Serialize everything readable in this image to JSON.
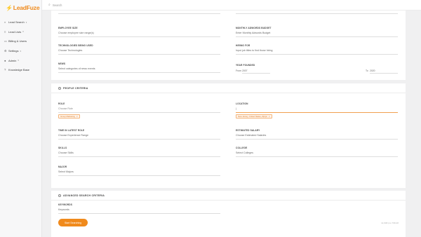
{
  "app": {
    "logo_text": "LeadFuze",
    "brand_color": "#f08a1c"
  },
  "search": {
    "placeholder": "Search",
    "icon": "search-icon"
  },
  "sidebar": {
    "items": [
      {
        "icon": "search-icon",
        "label": "Lead Search",
        "has_chevron": true
      },
      {
        "icon": "list-icon",
        "label": "Lead Lists",
        "has_chevron": true
      },
      {
        "icon": "card-icon",
        "label": "Billing & Users",
        "has_chevron": false
      },
      {
        "icon": "gear-icon",
        "label": "Settings",
        "has_chevron": true
      },
      {
        "icon": "user-icon",
        "label": "Admin",
        "has_chevron": true
      },
      {
        "icon": "help-icon",
        "label": "Knowledge Base",
        "has_chevron": false
      }
    ]
  },
  "company": {
    "employee_size": {
      "label": "EMPLOYEE SIZE",
      "value": "Choose employee size range(s)"
    },
    "adwords": {
      "label": "MONTHLY ADWORDS BUDGET",
      "value": "Enter Monthly Adwords Budget"
    },
    "tech": {
      "label": "TECHNOLOGIES BEING USED",
      "value": "Choose Technologies"
    },
    "hiring": {
      "label": "HIRING FOR",
      "value": "Input job titles to find those hiring"
    },
    "news": {
      "label": "NEWS",
      "value": "Select categories of news events"
    },
    "year_founded": {
      "label": "YEAR FOUNDED",
      "from_label": "From",
      "from_value": "2007",
      "to_label": "To",
      "to_value": "2020"
    }
  },
  "people": {
    "title": "PEOPLE CRITERIA",
    "role": {
      "label": "ROLE",
      "value": "Choose Role",
      "tag": "Group Marketing"
    },
    "location": {
      "label": "LOCATION",
      "value": "|",
      "tag": "New Jersey, United States, Zip/pc"
    },
    "time_in_role": {
      "label": "TIME IN LATEST ROLE",
      "value": "Choose Experience Range"
    },
    "salary": {
      "label": "ESTIMATED SALARY",
      "value": "Choose Estimated Salaries"
    },
    "skills": {
      "label": "SKILLS",
      "value": "Choose Skills"
    },
    "college": {
      "label": "COLLEGE",
      "value": "Select Colleges"
    },
    "major": {
      "label": "MAJOR",
      "value": "Select Majors"
    }
  },
  "advanced": {
    "title": "ADVANCED SEARCH CRITERIA",
    "keywords": {
      "label": "KEYWORDS",
      "value": "Keywords"
    },
    "start_button": "Start Searching",
    "credits": "11,698 (no 798,48"
  }
}
